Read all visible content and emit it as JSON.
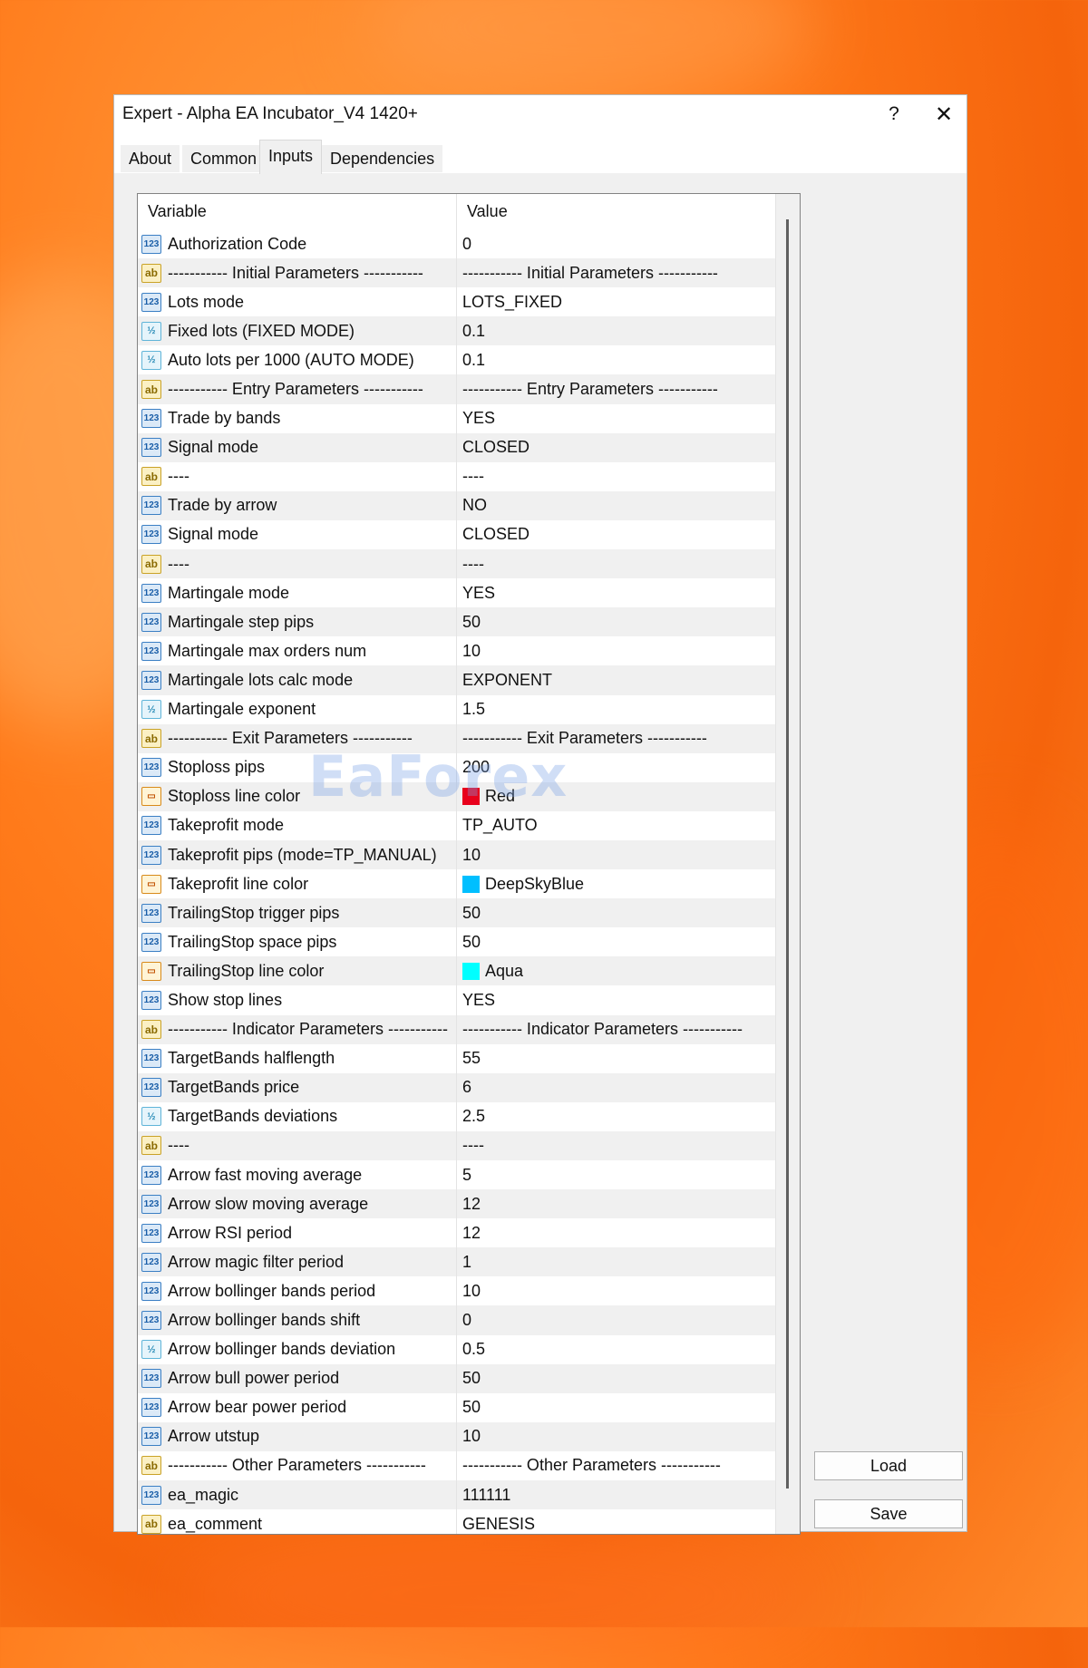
{
  "window": {
    "title": "Expert - Alpha EA Incubator_V4 1420+",
    "help": "?",
    "close": "✕"
  },
  "tabs": [
    {
      "label": "About"
    },
    {
      "label": "Common"
    },
    {
      "label": "Inputs"
    },
    {
      "label": "Dependencies"
    }
  ],
  "active_tab": "Inputs",
  "table": {
    "headers": {
      "variable": "Variable",
      "value": "Value"
    },
    "rows": [
      {
        "type": "int",
        "variable": "Authorization Code",
        "value": "0"
      },
      {
        "type": "str",
        "variable": "----------- Initial Parameters -----------",
        "value": "----------- Initial Parameters -----------"
      },
      {
        "type": "int",
        "variable": "Lots mode",
        "value": "LOTS_FIXED"
      },
      {
        "type": "dbl",
        "variable": "Fixed lots (FIXED MODE)",
        "value": "0.1"
      },
      {
        "type": "dbl",
        "variable": "Auto lots per 1000 (AUTO MODE)",
        "value": "0.1"
      },
      {
        "type": "str",
        "variable": "----------- Entry Parameters -----------",
        "value": "----------- Entry Parameters -----------"
      },
      {
        "type": "int",
        "variable": "Trade by bands",
        "value": "YES"
      },
      {
        "type": "int",
        "variable": "Signal mode",
        "value": "CLOSED"
      },
      {
        "type": "str",
        "variable": "----",
        "value": "----"
      },
      {
        "type": "int",
        "variable": "Trade by arrow",
        "value": "NO"
      },
      {
        "type": "int",
        "variable": "Signal mode",
        "value": "CLOSED"
      },
      {
        "type": "str",
        "variable": "----",
        "value": "----"
      },
      {
        "type": "int",
        "variable": "Martingale mode",
        "value": "YES"
      },
      {
        "type": "int",
        "variable": "Martingale step pips",
        "value": "50"
      },
      {
        "type": "int",
        "variable": "Martingale max orders num",
        "value": "10"
      },
      {
        "type": "int",
        "variable": "Martingale lots calc mode",
        "value": "EXPONENT"
      },
      {
        "type": "dbl",
        "variable": "Martingale exponent",
        "value": "1.5"
      },
      {
        "type": "str",
        "variable": "----------- Exit Parameters -----------",
        "value": "----------- Exit Parameters -----------"
      },
      {
        "type": "int",
        "variable": "Stoploss pips",
        "value": "200"
      },
      {
        "type": "clr",
        "variable": "Stoploss line color",
        "value": "Red",
        "swatch": "#e8001c"
      },
      {
        "type": "int",
        "variable": "Takeprofit mode",
        "value": "TP_AUTO"
      },
      {
        "type": "int",
        "variable": "Takeprofit pips (mode=TP_MANUAL)",
        "value": "10"
      },
      {
        "type": "clr",
        "variable": "Takeprofit line color",
        "value": "DeepSkyBlue",
        "swatch": "#00bfff"
      },
      {
        "type": "int",
        "variable": "TrailingStop trigger pips",
        "value": "50"
      },
      {
        "type": "int",
        "variable": "TrailingStop space pips",
        "value": "50"
      },
      {
        "type": "clr",
        "variable": "TrailingStop line color",
        "value": "Aqua",
        "swatch": "#00ffff"
      },
      {
        "type": "int",
        "variable": "Show stop lines",
        "value": "YES"
      },
      {
        "type": "str",
        "variable": "----------- Indicator Parameters -----------",
        "value": "----------- Indicator Parameters -----------"
      },
      {
        "type": "int",
        "variable": "TargetBands halflength",
        "value": "55"
      },
      {
        "type": "int",
        "variable": "TargetBands price",
        "value": "6"
      },
      {
        "type": "dbl",
        "variable": "TargetBands deviations",
        "value": "2.5"
      },
      {
        "type": "str",
        "variable": "----",
        "value": "----"
      },
      {
        "type": "int",
        "variable": "Arrow fast moving average",
        "value": "5"
      },
      {
        "type": "int",
        "variable": "Arrow slow moving average",
        "value": "12"
      },
      {
        "type": "int",
        "variable": "Arrow RSI period",
        "value": "12"
      },
      {
        "type": "int",
        "variable": "Arrow magic filter period",
        "value": "1"
      },
      {
        "type": "int",
        "variable": "Arrow bollinger bands period",
        "value": "10"
      },
      {
        "type": "int",
        "variable": "Arrow bollinger bands shift",
        "value": "0"
      },
      {
        "type": "dbl",
        "variable": "Arrow bollinger bands deviation",
        "value": "0.5"
      },
      {
        "type": "int",
        "variable": "Arrow bull power period",
        "value": "50"
      },
      {
        "type": "int",
        "variable": "Arrow bear power period",
        "value": "50"
      },
      {
        "type": "int",
        "variable": "Arrow utstup",
        "value": "10"
      },
      {
        "type": "str",
        "variable": "----------- Other Parameters -----------",
        "value": "----------- Other Parameters -----------"
      },
      {
        "type": "int",
        "variable": "ea_magic",
        "value": "111111"
      },
      {
        "type": "str",
        "variable": "ea_comment",
        "value": "GENESIS"
      }
    ]
  },
  "type_icons": {
    "int": "123",
    "dbl": "½",
    "str": "ab",
    "clr": "▭"
  },
  "buttons": {
    "load": "Load",
    "save": "Save"
  },
  "watermark": "EaForex"
}
